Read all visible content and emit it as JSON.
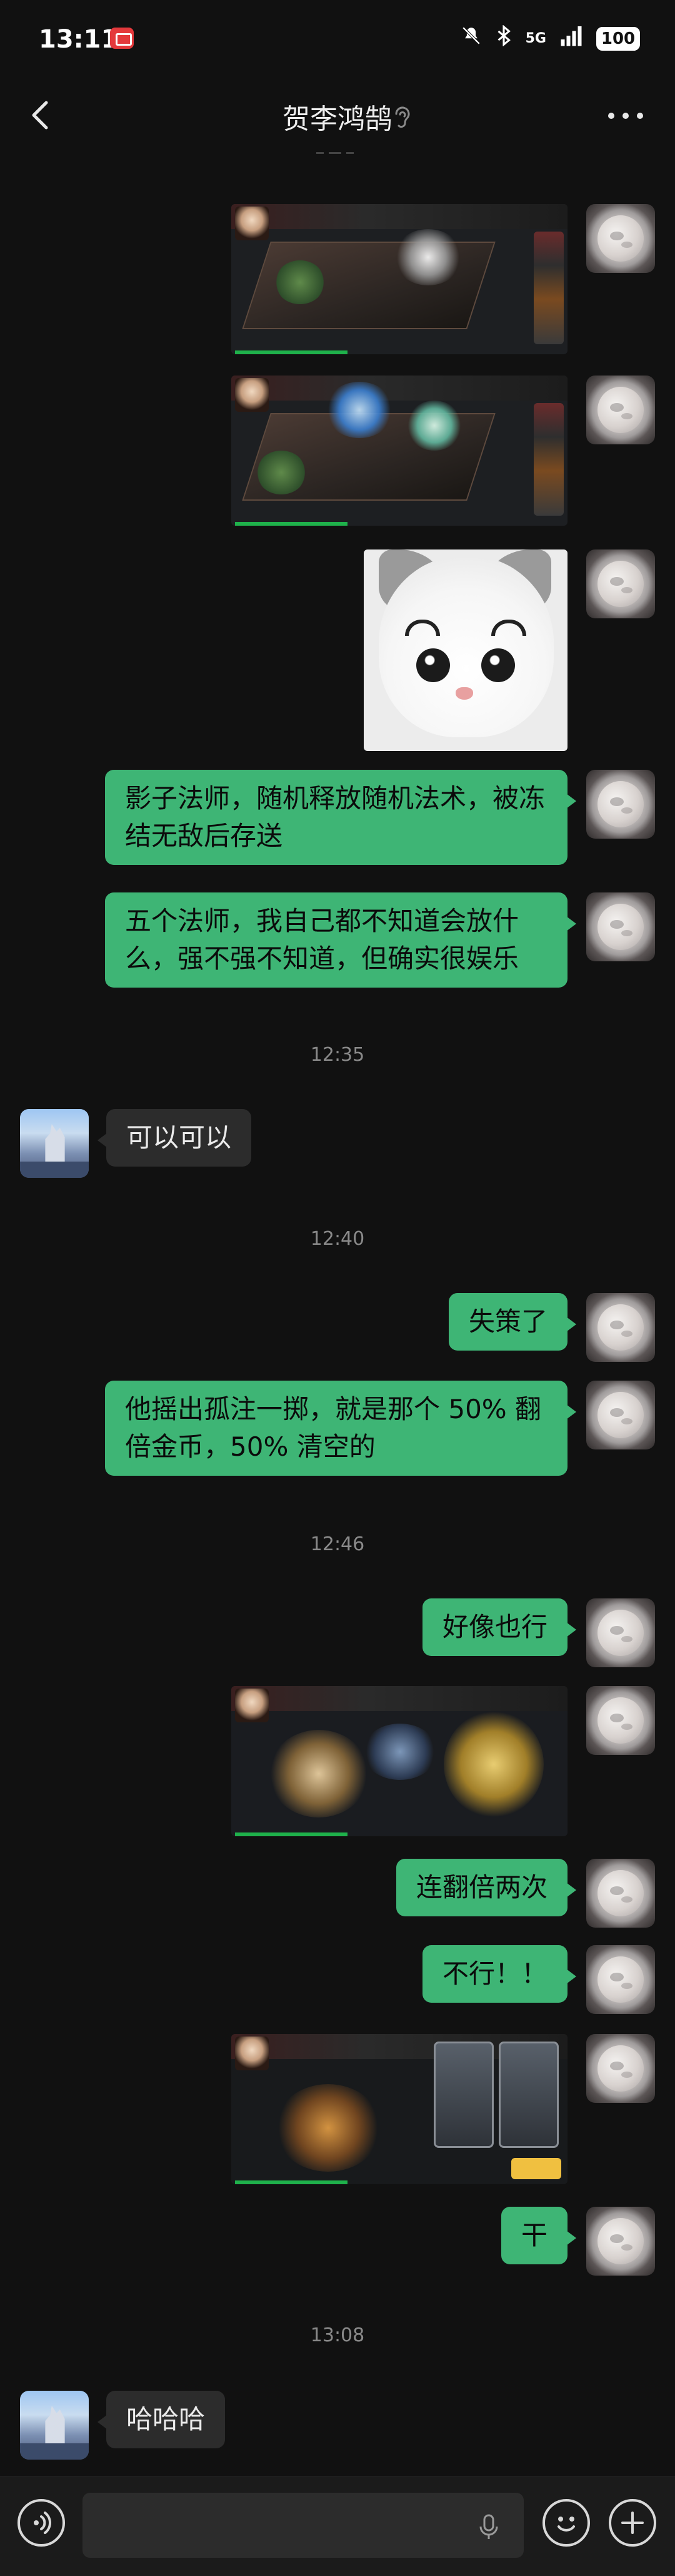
{
  "status_bar": {
    "time": "13:11",
    "network": "5G",
    "battery": "100"
  },
  "header": {
    "title": "贺李鸿鹄"
  },
  "chat": {
    "messages_me": {
      "m1": "影子法师，随机释放随机法术，被冻结无敌后存送",
      "m2": "五个法师，我自己都不知道会放什么，强不强不知道，但确实很娱乐",
      "m3": "失策了",
      "m4": "他摇出孤注一掷，就是那个 50% 翻倍金币，50% 清空的",
      "m5": "好像也行",
      "m6": "连翻倍两次",
      "m7": "不行！！",
      "m8": "干"
    },
    "messages_other": {
      "o1": "可以可以",
      "o2": "哈哈哈"
    },
    "timestamps": {
      "t1": "12:35",
      "t2": "12:40",
      "t3": "12:46",
      "t4": "13:08"
    }
  },
  "icons": {
    "back": "back-arrow-icon",
    "ear": "ear-icon",
    "more": "more-icon",
    "voice": "voice-icon",
    "mic": "microphone-icon",
    "emoji": "emoji-icon",
    "plus": "plus-icon"
  },
  "colors": {
    "background": "#111111",
    "bubble_me": "#3eb575",
    "bubble_other": "#2c2c2c",
    "timestamp": "#8a8a8a"
  }
}
